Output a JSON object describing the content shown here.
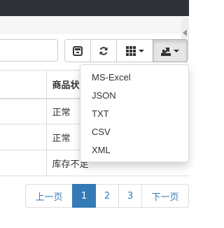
{
  "toolbar": {
    "buttons": [
      {
        "icon": "toggle-view-icon"
      },
      {
        "icon": "refresh-icon"
      },
      {
        "icon": "columns-grid-icon"
      },
      {
        "icon": "export-icon"
      }
    ]
  },
  "table": {
    "header": [
      "",
      "商品状"
    ],
    "rows": [
      [
        "",
        "正常"
      ],
      [
        "",
        "正常"
      ],
      [
        "",
        "库存不足"
      ]
    ]
  },
  "export_menu": {
    "items": [
      "MS-Excel",
      "JSON",
      "TXT",
      "CSV",
      "XML"
    ]
  },
  "pagination": {
    "prev": "上一页",
    "pages": [
      "1",
      "2",
      "3"
    ],
    "active_page": "1",
    "next": "下一页"
  },
  "colors": {
    "topbar": "#2f3238",
    "accent": "#337ab7",
    "border": "#dddddd"
  }
}
